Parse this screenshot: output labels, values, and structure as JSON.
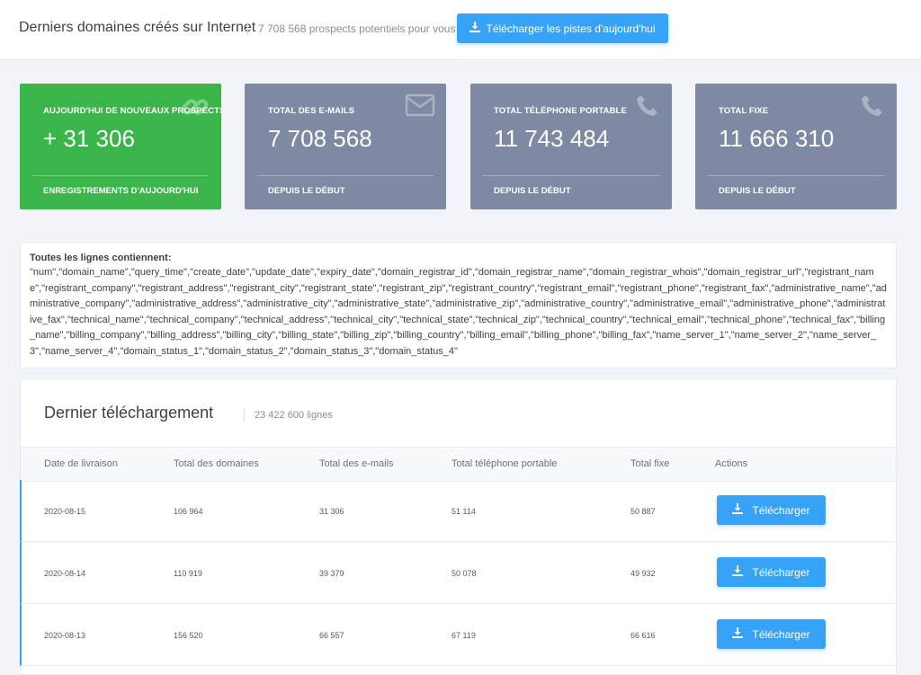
{
  "header": {
    "title": "Derniers domaines créés sur Internet",
    "subtitle": "7 708 568 prospects potentiels pour vous",
    "download_today_label": "Télécharger les pistes d'aujourd'hui"
  },
  "cards": [
    {
      "label": "AUJOURD'HUI DE NOUVEAUX PROSPECTS",
      "value": "+ 31 306",
      "foot": "ENREGISTREMENTS D'AUJOURD'HUI",
      "icon": "link-icon",
      "color": "#3ab54a"
    },
    {
      "label": "TOTAL DES E-MAILS",
      "value": "7 708 568",
      "foot": "DEPUIS LE DÉBUT",
      "icon": "envelope-icon",
      "color": "#7e8aa4"
    },
    {
      "label": "TOTAL TÉLÉPHONE PORTABLE",
      "value": "11 743 484",
      "foot": "DEPUIS LE DÉBUT",
      "icon": "phone-icon",
      "color": "#7e8aa4"
    },
    {
      "label": "TOTAL FIXE",
      "value": "11 666 310",
      "foot": "DEPUIS LE DÉBUT",
      "icon": "phone-icon",
      "color": "#7e8aa4"
    }
  ],
  "fields": {
    "title": "Toutes les lignes contiennent:",
    "text": "\"num\",\"domain_name\",\"query_time\",\"create_date\",\"update_date\",\"expiry_date\",\"domain_registrar_id\",\"domain_registrar_name\",\"domain_registrar_whois\",\"domain_registrar_url\",\"registrant_name\",\"registrant_company\",\"registrant_address\",\"registrant_city\",\"registrant_state\",\"registrant_zip\",\"registrant_country\",\"registrant_email\",\"registrant_phone\",\"registrant_fax\",\"administrative_name\",\"administrative_company\",\"administrative_address\",\"administrative_city\",\"administrative_state\",\"administrative_zip\",\"administrative_country\",\"administrative_email\",\"administrative_phone\",\"administrative_fax\",\"technical_name\",\"technical_company\",\"technical_address\",\"technical_city\",\"technical_state\",\"technical_zip\",\"technical_country\",\"technical_email\",\"technical_phone\",\"technical_fax\",\"billing_name\",\"billing_company\",\"billing_address\",\"billing_city\",\"billing_state\",\"billing_zip\",\"billing_country\",\"billing_email\",\"billing_phone\",\"billing_fax\",\"name_server_1\",\"name_server_2\",\"name_server_3\",\"name_server_4\",\"domain_status_1\",\"domain_status_2\",\"domain_status_3\",\"domain_status_4\""
  },
  "panel": {
    "title": "Dernier téléchargement",
    "subtitle": "23 422 600 lignes",
    "columns": [
      "Date de livraison",
      "Total des domaines",
      "Total des e-mails",
      "Total téléphone portable",
      "Total fixe",
      "Actions"
    ],
    "rows": [
      {
        "date": "2020-08-15",
        "domains": "106 964",
        "emails": "31 306",
        "mobile": "51 114",
        "fixe": "50 887",
        "action": "Télécharger"
      },
      {
        "date": "2020-08-14",
        "domains": "110 919",
        "emails": "39 379",
        "mobile": "50 078",
        "fixe": "49 932",
        "action": "Télécharger"
      },
      {
        "date": "2020-08-13",
        "domains": "156 520",
        "emails": "66 557",
        "mobile": "67 119",
        "fixe": "66 616",
        "action": "Télécharger"
      }
    ]
  },
  "colors": {
    "accent": "#36a3f7",
    "success": "#3ab54a",
    "card_gray": "#7e8aa4"
  }
}
